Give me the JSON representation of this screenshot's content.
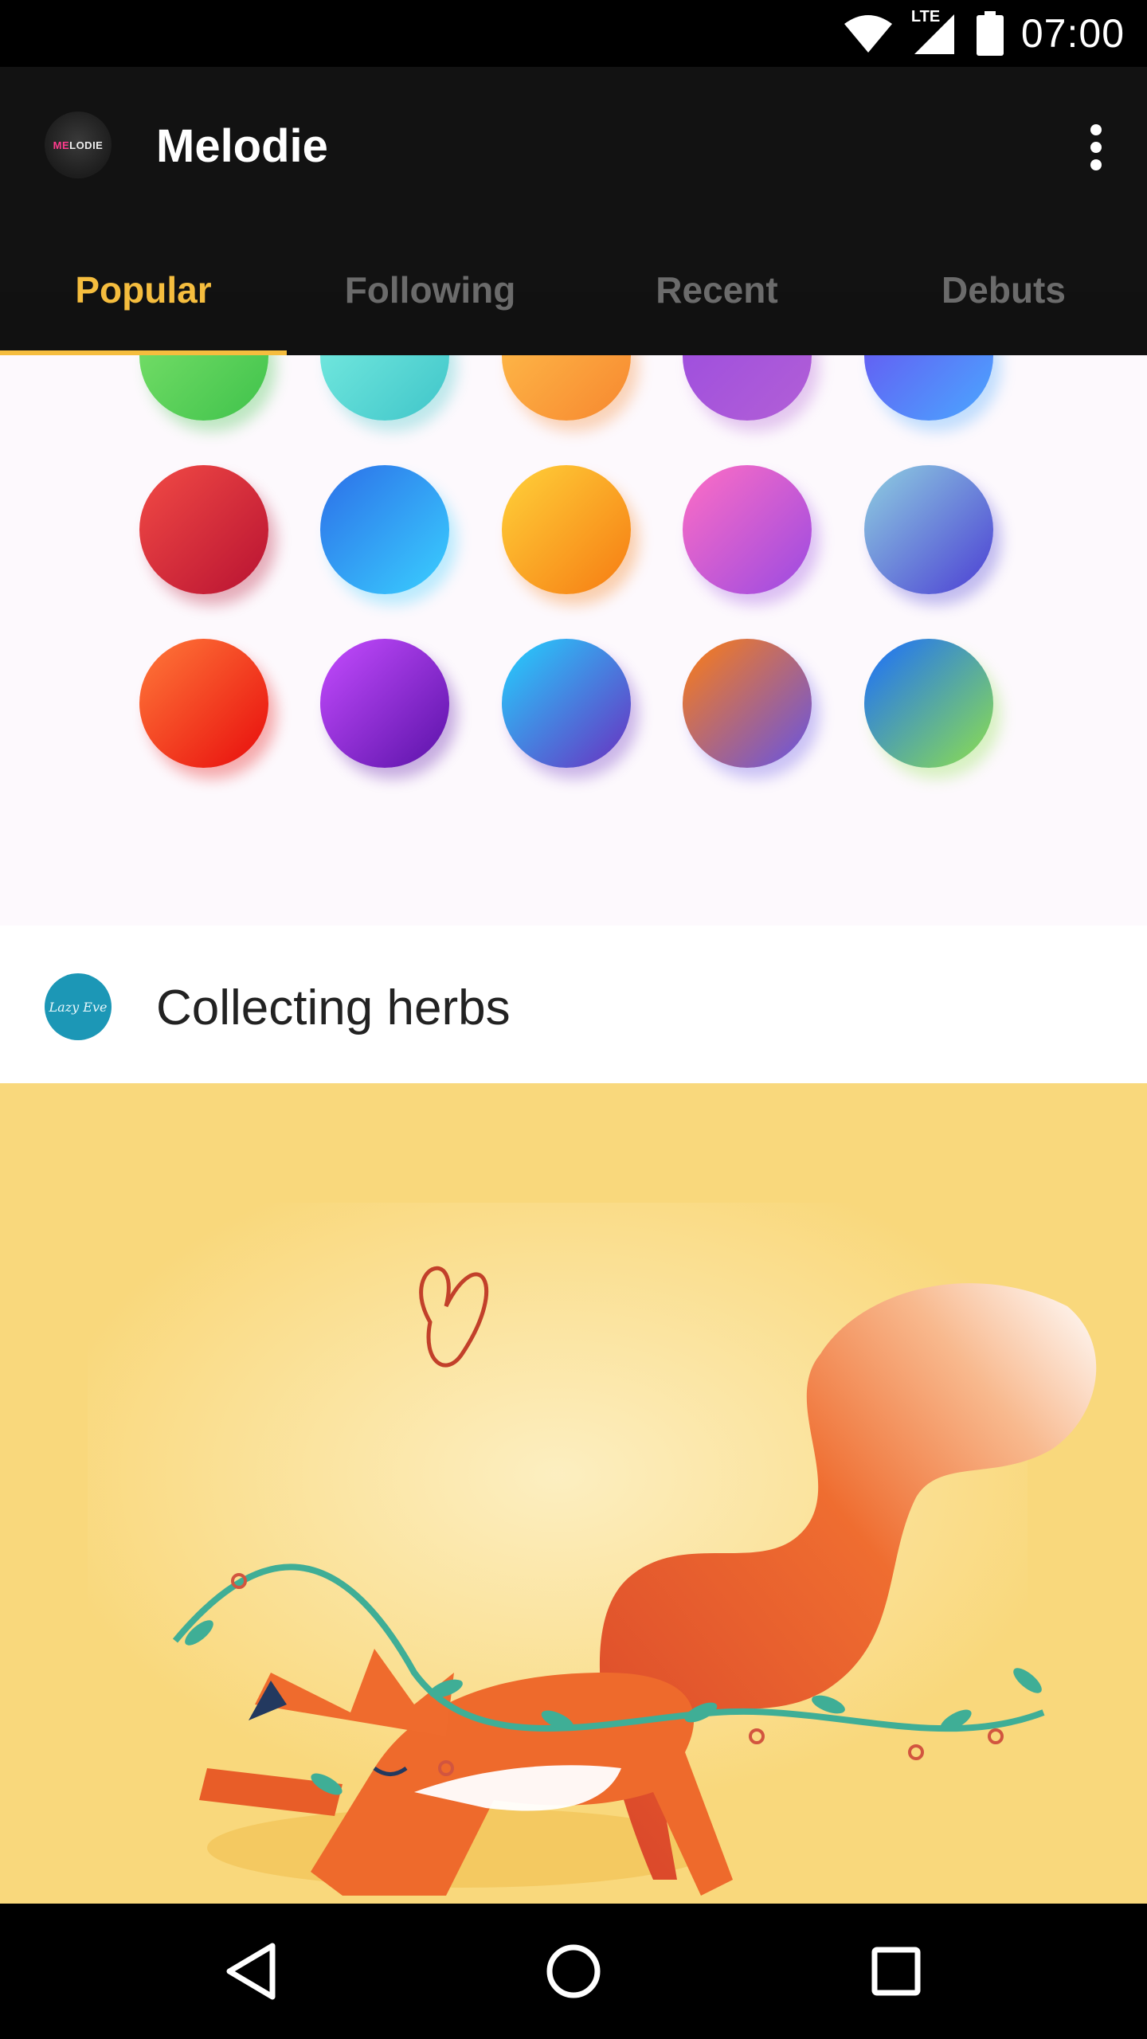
{
  "status_bar": {
    "time": "07:00",
    "network_label": "LTE",
    "icons": [
      "wifi-icon",
      "cell-signal-icon",
      "battery-icon"
    ]
  },
  "app_bar": {
    "logo_text_pink": "ME",
    "logo_text_white": "LODIE",
    "title": "Melodie",
    "menu_icon": "overflow-menu-icon"
  },
  "tabs": [
    {
      "label": "Popular",
      "active": true
    },
    {
      "label": "Following",
      "active": false
    },
    {
      "label": "Recent",
      "active": false
    },
    {
      "label": "Debuts",
      "active": false
    }
  ],
  "palette": {
    "rows": [
      [
        [
          "#7fe36d",
          "#3fc24b"
        ],
        [
          "#7ef0e3",
          "#3fc5c9"
        ],
        [
          "#ffc24d",
          "#f7872f"
        ],
        [
          "#9a4be0",
          "#b25fd6"
        ],
        [
          "#6a4bf0",
          "#4aa8ff"
        ]
      ],
      [
        [
          "#f24b45",
          "#b81232"
        ],
        [
          "#2c6ee8",
          "#3ad0ff"
        ],
        [
          "#ffd23a",
          "#f67b12"
        ],
        [
          "#ff6ec4",
          "#9a4ae2"
        ],
        [
          "#8fd0e0",
          "#4b3ed4"
        ]
      ],
      [
        [
          "#ff7a3a",
          "#e80c0c"
        ],
        [
          "#c54cff",
          "#5a12a8"
        ],
        [
          "#23d3ff",
          "#6a2fc0"
        ],
        [
          "#ff7e10",
          "#6553e6"
        ],
        [
          "#1a6cff",
          "#8ee04c"
        ]
      ]
    ]
  },
  "post": {
    "avatar_text": "Lazy Eve",
    "title": "Collecting herbs",
    "artwork_name": "fox-collecting-herbs-illustration"
  },
  "nav_bar": {
    "buttons": [
      "back-icon",
      "home-icon",
      "recents-icon"
    ]
  },
  "colors": {
    "accent": "#f5bd3e",
    "app_bar_bg": "#121212",
    "artwork_bg": "#f9d87c",
    "fox_orange": "#ee6a2c"
  }
}
